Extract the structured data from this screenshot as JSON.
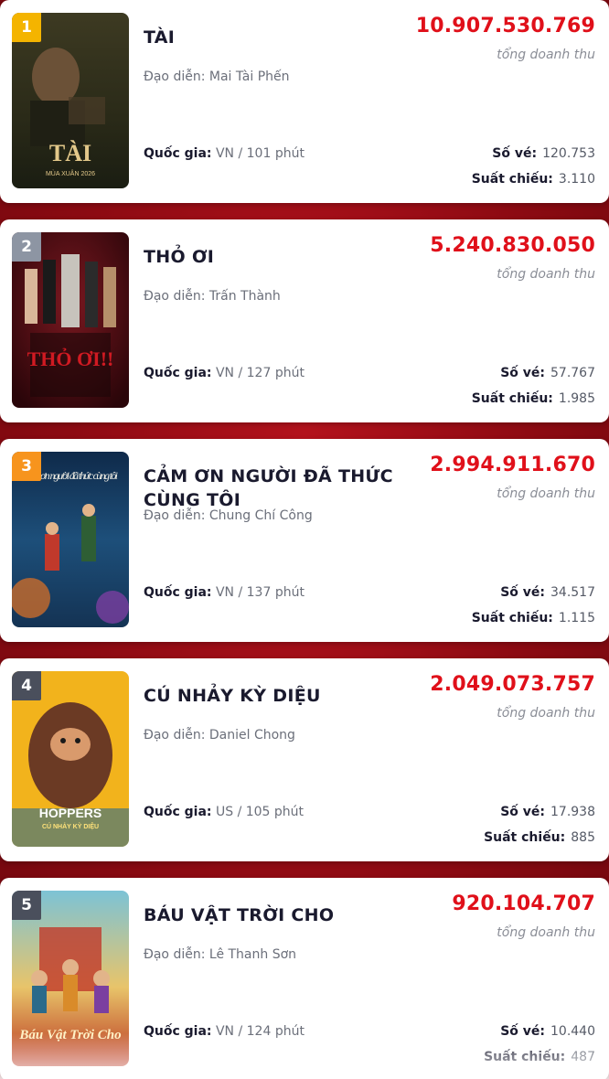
{
  "movies": [
    {
      "rank": "1",
      "rank_color": "#f4b400",
      "title": "TÀI",
      "director_label": "Đạo diễn:",
      "director": "Mai Tài Phến",
      "country_label": "Quốc gia:",
      "country_runtime": "VN / 101 phút",
      "revenue": "10.907.530.769",
      "revenue_label": "tổng doanh thu",
      "tickets_label": "Số vé:",
      "tickets": "120.753",
      "shows_label": "Suất chiếu:",
      "shows": "3.110",
      "poster_icon": "poster-tai",
      "poster_text": "TÀI",
      "poster_subtext": "MÙA XUÂN 2026"
    },
    {
      "rank": "2",
      "rank_color": "#8d95a3",
      "title": "THỎ ƠI",
      "director_label": "Đạo diễn:",
      "director": "Trấn Thành",
      "country_label": "Quốc gia:",
      "country_runtime": "VN / 127 phút",
      "revenue": "5.240.830.050",
      "revenue_label": "tổng doanh thu",
      "tickets_label": "Số vé:",
      "tickets": "57.767",
      "shows_label": "Suất chiếu:",
      "shows": "1.985",
      "poster_icon": "poster-tho-oi",
      "poster_text": "THỎ ƠI!!"
    },
    {
      "rank": "3",
      "rank_color": "#f7941d",
      "title": "CẢM ƠN NGƯỜI ĐÃ THỨC CÙNG TÔI",
      "director_label": "Đạo diễn:",
      "director": "Chung Chí Công",
      "country_label": "Quốc gia:",
      "country_runtime": "VN / 137 phút",
      "revenue": "2.994.911.670",
      "revenue_label": "tổng doanh thu",
      "tickets_label": "Số vé:",
      "tickets": "34.517",
      "shows_label": "Suất chiếu:",
      "shows": "1.115",
      "poster_icon": "poster-cam-on",
      "poster_text": "Cảm ơn người đã thức cùng tôi"
    },
    {
      "rank": "4",
      "rank_color": "#4a4f5c",
      "title": "CÚ NHẢY KỲ DIỆU",
      "director_label": "Đạo diễn:",
      "director": "Daniel Chong",
      "country_label": "Quốc gia:",
      "country_runtime": "US / 105 phút",
      "revenue": "2.049.073.757",
      "revenue_label": "tổng doanh thu",
      "tickets_label": "Số vé:",
      "tickets": "17.938",
      "shows_label": "Suất chiếu:",
      "shows": "885",
      "poster_icon": "poster-hoppers",
      "poster_text": "HOPPERS",
      "poster_subtext": "CÚ NHẢY KỲ DIỆU"
    },
    {
      "rank": "5",
      "rank_color": "#4a4f5c",
      "title": "BÁU VẬT TRỜI CHO",
      "director_label": "Đạo diễn:",
      "director": "Lê Thanh Sơn",
      "country_label": "Quốc gia:",
      "country_runtime": "VN / 124 phút",
      "revenue": "920.104.707",
      "revenue_label": "tổng doanh thu",
      "tickets_label": "Số vé:",
      "tickets": "10.440",
      "shows_label": "Suất chiếu:",
      "shows": "487",
      "poster_icon": "poster-bau-vat",
      "poster_text": "Báu Vật Trời Cho"
    }
  ],
  "colors": {
    "accent": "#e0101a",
    "title": "#1a1a2e",
    "muted": "#6b6f7a"
  }
}
